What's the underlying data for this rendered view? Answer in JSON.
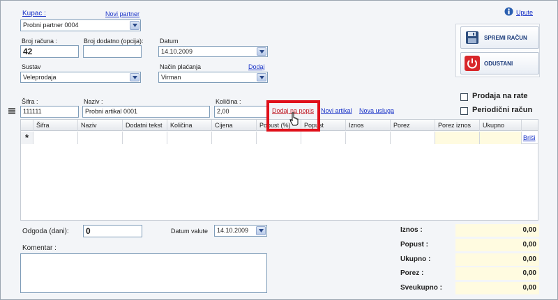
{
  "header": {
    "kupac_label": "Kupac :",
    "novi_partner_label": "Novi partner",
    "kupac_value": "Probni partner 0004",
    "upute_label": "Upute"
  },
  "form": {
    "broj_racuna_label": "Broj računa :",
    "broj_racuna_value": "42",
    "broj_dodatno_label": "Broj dodatno (opcija):",
    "broj_dodatno_value": "",
    "datum_label": "Datum",
    "datum_value": "14.10.2009",
    "sustav_label": "Sustav",
    "sustav_value": "Veleprodaja",
    "nacin_placanja_label": "Način plaćanja",
    "dodaj_label": "Dodaj",
    "nacin_placanja_value": "Virman"
  },
  "actions": {
    "spremi_label": "SPREMI RAČUN",
    "odustani_label": "ODUSTANI"
  },
  "options": {
    "prodaja_na_rate_label": "Prodaja na rate",
    "periodicni_label": "Periodični račun"
  },
  "item_entry": {
    "sifra_label": "Šifra :",
    "sifra_value": "111111",
    "naziv_label": "Naziv :",
    "naziv_value": "Probni artikal 0001",
    "kolicina_label": "Količina :",
    "kolicina_value": "2,00",
    "dodaj_na_popis_label": "Dodaj na popis",
    "novi_artikal_label": "Novi artikal",
    "nova_usluga_label": "Nova usluga"
  },
  "grid": {
    "columns": [
      "Šifra",
      "Naziv",
      "Dodatni tekst",
      "Količina",
      "Cijena",
      "Popust (%)",
      "Popust",
      "Iznos",
      "Porez",
      "Porez iznos",
      "Ukupno"
    ],
    "new_row_marker": "*",
    "brisi_label": "Briši"
  },
  "footer": {
    "odgoda_label": "Odgoda (dani):",
    "odgoda_value": "0",
    "datum_valute_label": "Datum valute",
    "datum_valute_value": "14.10.2009",
    "komentar_label": "Komentar :",
    "komentar_value": ""
  },
  "totals": {
    "iznos_label": "Iznos :",
    "iznos_value": "0,00",
    "popust_label": "Popust :",
    "popust_value": "0,00",
    "ukupno_label": "Ukupno :",
    "ukupno_value": "0,00",
    "porez_label": "Porez :",
    "porez_value": "0,00",
    "sveukupno_label": "Sveukupno :",
    "sveukupno_value": "0,00"
  },
  "colors": {
    "link": "#1a34c8",
    "highlight": "#e0101a",
    "field_border": "#7f9db9",
    "total_bg": "#fffbe0"
  }
}
